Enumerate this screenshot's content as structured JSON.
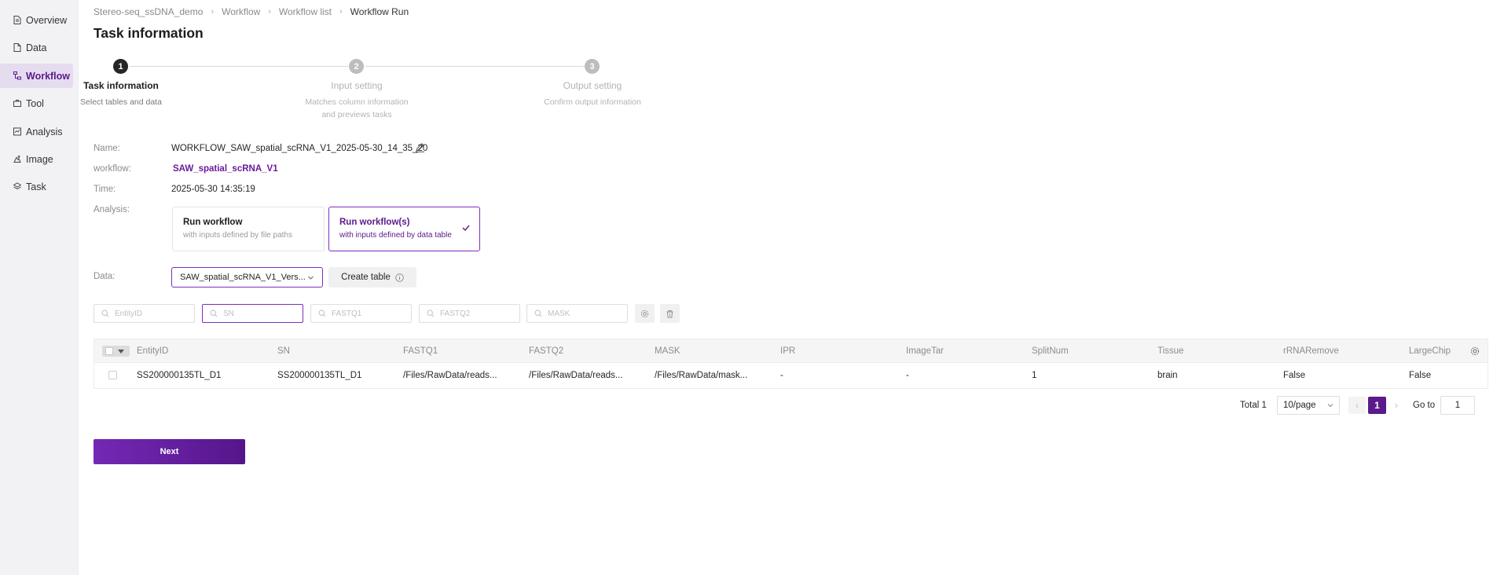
{
  "sidebar": {
    "items": [
      {
        "label": "Overview",
        "icon": "document-icon"
      },
      {
        "label": "Data",
        "icon": "file-icon"
      },
      {
        "label": "Workflow",
        "icon": "workflow-icon",
        "active": true
      },
      {
        "label": "Tool",
        "icon": "toolbox-icon"
      },
      {
        "label": "Analysis",
        "icon": "chart-icon"
      },
      {
        "label": "Image",
        "icon": "image-icon"
      },
      {
        "label": "Task",
        "icon": "layers-icon"
      }
    ]
  },
  "breadcrumb": [
    "Stereo-seq_ssDNA_demo",
    "Workflow",
    "Workflow list",
    "Workflow Run"
  ],
  "page_title": "Task information",
  "steps": [
    {
      "num": "1",
      "title": "Task information",
      "desc": "Select tables and data",
      "desc2": ""
    },
    {
      "num": "2",
      "title": "Input setting",
      "desc": "Matches column information",
      "desc2": "and previews tasks"
    },
    {
      "num": "3",
      "title": "Output setting",
      "desc": "Confirm output information",
      "desc2": ""
    }
  ],
  "form": {
    "name_label": "Name:",
    "name_value": "WORKFLOW_SAW_spatial_scRNA_V1_2025-05-30_14_35_20",
    "workflow_label": "workflow:",
    "workflow_value": "SAW_spatial_scRNA_V1",
    "time_label": "Time:",
    "time_value": "2025-05-30 14:35:19",
    "analysis_label": "Analysis:",
    "analysis_options": [
      {
        "title": "Run workflow",
        "desc": "with inputs defined by file paths"
      },
      {
        "title": "Run workflow(s)",
        "desc": "with inputs defined by data table",
        "selected": true
      }
    ],
    "data_label": "Data:",
    "data_select_value": "SAW_spatial_scRNA_V1_Vers...",
    "create_table_label": "Create table"
  },
  "filters": [
    {
      "placeholder": "EntityID"
    },
    {
      "placeholder": "SN"
    },
    {
      "placeholder": "FASTQ1"
    },
    {
      "placeholder": "FASTQ2"
    },
    {
      "placeholder": "MASK"
    }
  ],
  "table": {
    "columns": [
      "EntityID",
      "SN",
      "FASTQ1",
      "FASTQ2",
      "MASK",
      "IPR",
      "ImageTar",
      "SplitNum",
      "Tissue",
      "rRNARemove",
      "LargeChip"
    ],
    "rows": [
      [
        "SS200000135TL_D1",
        "SS200000135TL_D1",
        "/Files/RawData/reads...",
        "/Files/RawData/reads...",
        "/Files/RawData/mask...",
        "-",
        "-",
        "1",
        "brain",
        "False",
        "False"
      ]
    ]
  },
  "pagination": {
    "total": "Total 1",
    "page_size": "10/page",
    "prev": "‹",
    "current": "1",
    "next": "›",
    "goto_label": "Go to",
    "goto_value": "1"
  },
  "next_button": "Next",
  "colors": {
    "accent": "#5b1a8c",
    "accent_light": "#e6dcef",
    "border_focus": "#7b2fbe"
  }
}
